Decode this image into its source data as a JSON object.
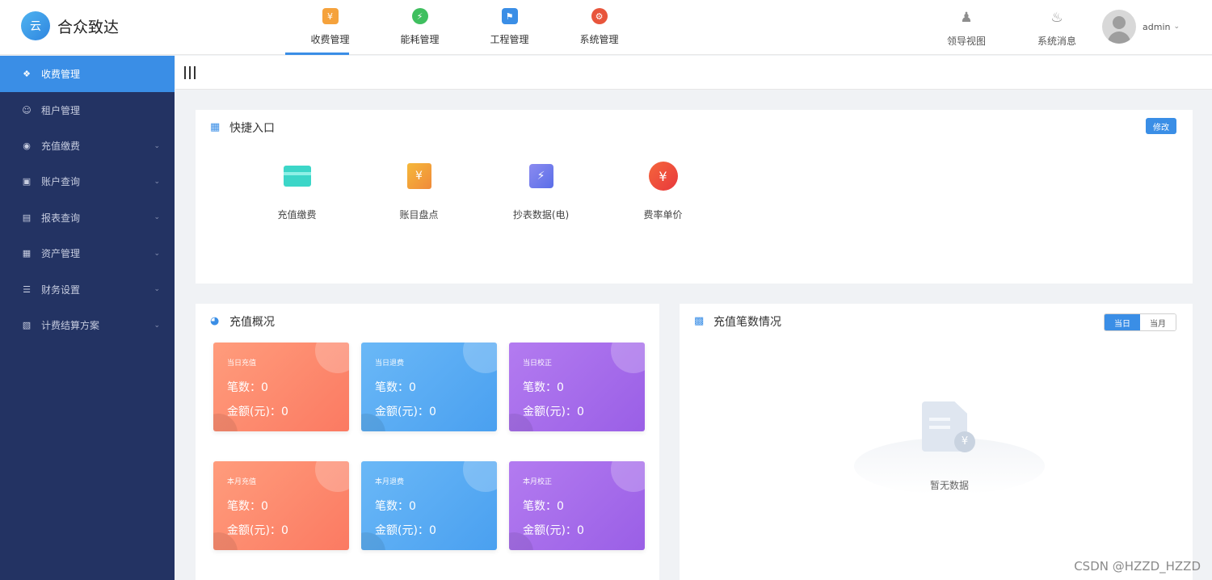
{
  "app": {
    "logo_text": "合众致达",
    "logo_mark": "云"
  },
  "topnav": [
    {
      "label": "收费管理",
      "icon": "fee-icon",
      "glyph": "¥",
      "active": true
    },
    {
      "label": "能耗管理",
      "icon": "energy-icon",
      "glyph": "⚡",
      "active": false
    },
    {
      "label": "工程管理",
      "icon": "engineering-icon",
      "glyph": "⚑",
      "active": false
    },
    {
      "label": "系统管理",
      "icon": "system-gear-icon",
      "glyph": "⚙",
      "active": false
    }
  ],
  "tools": [
    {
      "label": "领导视图",
      "icon": "person-icon"
    },
    {
      "label": "系统消息",
      "icon": "bell-icon"
    }
  ],
  "user": {
    "name": "admin"
  },
  "sidebar": {
    "items": [
      {
        "label": "收费管理",
        "icon": "info-icon",
        "active": true,
        "caret": false
      },
      {
        "label": "租户管理",
        "icon": "tenant-icon",
        "active": false,
        "caret": false
      },
      {
        "label": "充值缴费",
        "icon": "recharge-icon",
        "active": false,
        "caret": true
      },
      {
        "label": "账户查询",
        "icon": "account-icon",
        "active": false,
        "caret": true
      },
      {
        "label": "报表查询",
        "icon": "report-icon",
        "active": false,
        "caret": true
      },
      {
        "label": "资产管理",
        "icon": "asset-icon",
        "active": false,
        "caret": true
      },
      {
        "label": "财务设置",
        "icon": "finance-icon",
        "active": false,
        "caret": true
      },
      {
        "label": "计费结算方案",
        "icon": "billing-plan-icon",
        "active": false,
        "caret": true
      }
    ]
  },
  "quick": {
    "title": "快捷入口",
    "edit_label": "修改",
    "items": [
      {
        "label": "充值缴费",
        "icon": "card-icon"
      },
      {
        "label": "账目盘点",
        "icon": "bill-icon"
      },
      {
        "label": "抄表数据(电)",
        "icon": "meter-icon"
      },
      {
        "label": "费率单价",
        "icon": "rate-icon"
      }
    ]
  },
  "recharge": {
    "title": "充值概况",
    "count_label": "笔数：",
    "amount_label": "金额(元)：",
    "cards": [
      {
        "title": "当日充值",
        "count": "0",
        "amount": "0",
        "color": "orange"
      },
      {
        "title": "当日退费",
        "count": "0",
        "amount": "0",
        "color": "blue"
      },
      {
        "title": "当日校正",
        "count": "0",
        "amount": "0",
        "color": "purple"
      },
      {
        "title": "本月充值",
        "count": "0",
        "amount": "0",
        "color": "orange"
      },
      {
        "title": "本月退费",
        "count": "0",
        "amount": "0",
        "color": "blue"
      },
      {
        "title": "本月校正",
        "count": "0",
        "amount": "0",
        "color": "purple"
      }
    ]
  },
  "count_panel": {
    "title": "充值笔数情况",
    "tabs": [
      {
        "label": "当日",
        "active": true
      },
      {
        "label": "当月",
        "active": false
      }
    ],
    "empty_text": "暂无数据"
  },
  "watermark": "CSDN @HZZD_HZZD",
  "colors": {
    "accent": "#3a8ee6",
    "sidebar_bg": "#233363"
  }
}
